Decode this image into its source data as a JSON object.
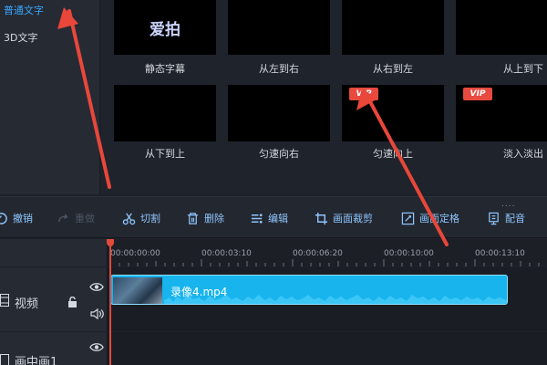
{
  "categories": [
    {
      "label": "普通文字",
      "active": true
    },
    {
      "label": "3D文字",
      "active": false
    }
  ],
  "effects": [
    {
      "label": "静态字幕",
      "thumb_text": "爱拍",
      "vip": false
    },
    {
      "label": "从左到右",
      "thumb_text": "",
      "vip": false
    },
    {
      "label": "从右到左",
      "thumb_text": "",
      "vip": false
    },
    {
      "label": "从上到下",
      "thumb_text": "",
      "vip": false
    },
    {
      "label": "从下到上",
      "thumb_text": "",
      "vip": false
    },
    {
      "label": "匀速向右",
      "thumb_text": "",
      "vip": false
    },
    {
      "label": "匀速向上",
      "thumb_text": "",
      "vip": true
    },
    {
      "label": "淡入淡出",
      "thumb_text": "",
      "vip": true
    }
  ],
  "vip_badge": "VIP",
  "toolbar": {
    "undo": "撤销",
    "redo": "重做",
    "cut": "切割",
    "delete": "删除",
    "edit": "编辑",
    "crop": "画面裁剪",
    "freeze": "画面定格",
    "dub": "配音",
    "more": "...."
  },
  "timeline": {
    "ticks": [
      "00:00:00:00",
      "00:00:03:10",
      "00:00:06:20",
      "00:00:10:00",
      "00:00:13:10"
    ],
    "tracks": [
      {
        "name": "视频"
      },
      {
        "name": "画中画1"
      }
    ],
    "clip": {
      "name": "录像4.mp4"
    }
  },
  "colors": {
    "accent": "#3aa7ff",
    "clip": "#17b4ee",
    "playhead": "#e04b3c",
    "annotation_arrow": "#e8473a"
  },
  "icons": {
    "undo": "undo-icon",
    "redo": "redo-icon",
    "cut": "scissors-icon",
    "delete": "trash-icon",
    "edit": "edit-icon",
    "crop": "crop-icon",
    "freeze": "freeze-frame-icon",
    "dub": "microphone-icon"
  }
}
